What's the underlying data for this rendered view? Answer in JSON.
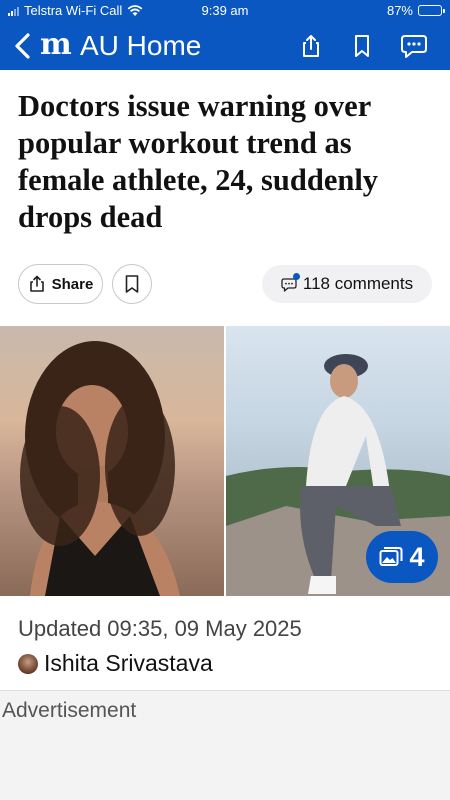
{
  "status_bar": {
    "carrier": "Telstra Wi-Fi Call",
    "time": "9:39 am",
    "battery": "87%",
    "battery_level": 0.87,
    "icons": [
      "signal-icon",
      "wifi-icon",
      "battery-icon"
    ]
  },
  "nav": {
    "logo": "m",
    "title": "AU Home",
    "icons": [
      "back-icon",
      "share-icon",
      "bookmark-icon",
      "comments-icon"
    ]
  },
  "article": {
    "headline": "Doctors issue warning over popular workout trend as female athlete, 24, suddenly drops dead",
    "share_label": "Share",
    "comments_label": "118 comments",
    "gallery_count": "4",
    "updated": "Updated 09:35, 09 May 2025",
    "author": "Ishita Srivastava"
  },
  "ad": {
    "label": "Advertisement"
  },
  "colors": {
    "brand": "#0a57c2",
    "comments_bg": "#f1f1f3"
  }
}
